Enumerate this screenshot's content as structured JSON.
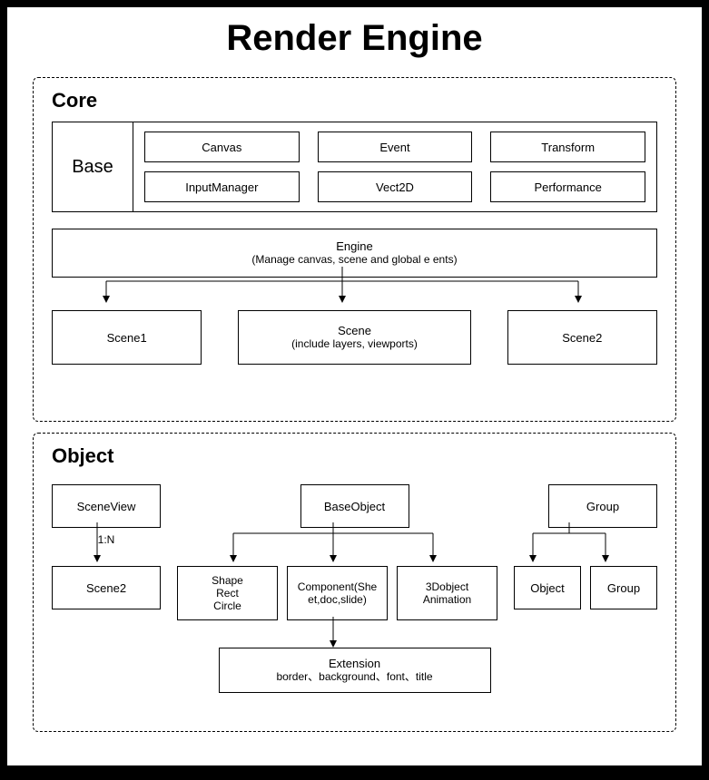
{
  "title": "Render Engine",
  "core": {
    "title": "Core",
    "base_label": "Base",
    "base_items": [
      "Canvas",
      "Event",
      "Transform",
      "InputManager",
      "Vect2D",
      "Performance"
    ],
    "engine": {
      "label": "Engine",
      "sub": "(Manage canvas, scene and global e ents)"
    },
    "scenes": {
      "left": "Scene1",
      "mid_label": "Scene",
      "mid_sub": "(include layers, viewports)",
      "right": "Scene2"
    }
  },
  "object": {
    "title": "Object",
    "top": {
      "left": "SceneView",
      "mid": "BaseObject",
      "right": "Group"
    },
    "rel": "1:N",
    "left_child": "Scene2",
    "center_children": {
      "a": "Shape\nRect\nCircle",
      "b": "Component(She\net,doc,slide)",
      "c": "3Dobject\nAnimation"
    },
    "right_children": {
      "a": "Object",
      "b": "Group"
    },
    "extension": {
      "label": "Extension",
      "sub": "border、background、font、title"
    }
  }
}
